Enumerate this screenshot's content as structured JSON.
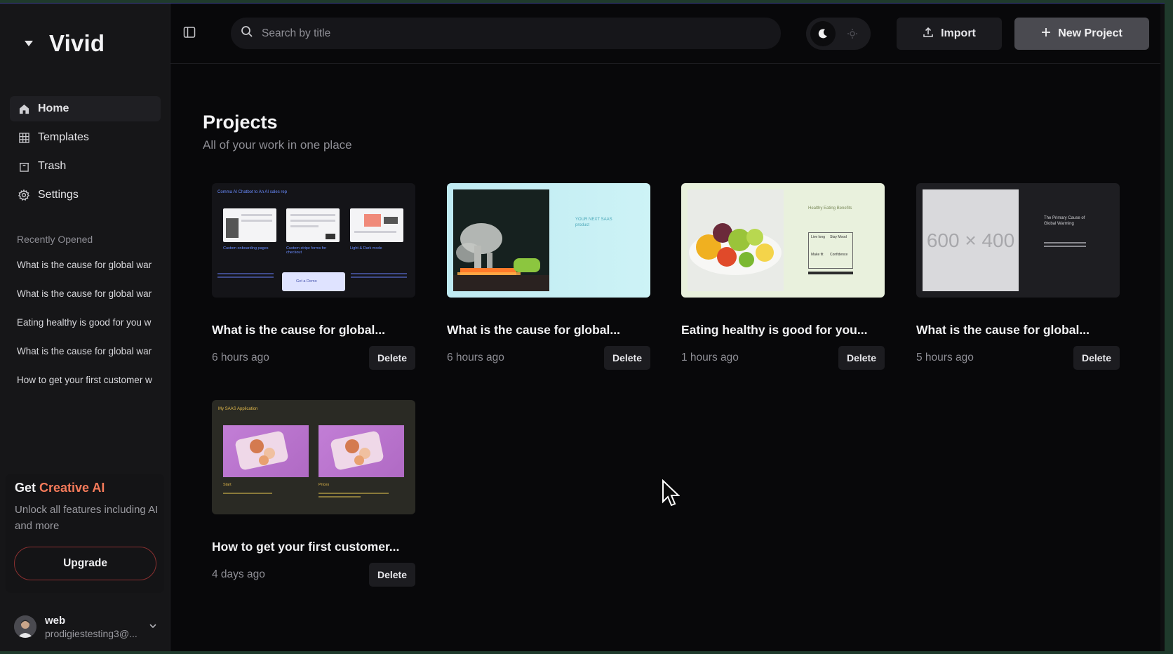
{
  "app": {
    "name": "Vivid"
  },
  "sidebar": {
    "nav": [
      {
        "label": "Home",
        "icon": "home-icon",
        "active": true
      },
      {
        "label": "Templates",
        "icon": "grid-icon",
        "active": false
      },
      {
        "label": "Trash",
        "icon": "trash-icon",
        "active": false
      },
      {
        "label": "Settings",
        "icon": "gear-icon",
        "active": false
      }
    ],
    "recent_title": "Recently Opened",
    "recent": [
      "What is the cause for global war",
      "What is the cause for global war",
      "Eating healthy is good for you w",
      "What is the cause for global war",
      "How to get your first customer w"
    ],
    "promo": {
      "title_prefix": "Get ",
      "title_accent": "Creative AI",
      "description": "Unlock all features including AI and more",
      "button": "Upgrade"
    },
    "user": {
      "name": "web",
      "email": "prodigiestesting3@..."
    }
  },
  "topbar": {
    "search_placeholder": "Search by title",
    "import_label": "Import",
    "new_project_label": "New Project"
  },
  "main": {
    "title": "Projects",
    "subtitle": "All of your work in one place",
    "delete_label": "Delete",
    "projects": [
      {
        "title": "What is the cause for global...",
        "time": "6 hours ago"
      },
      {
        "title": "What is the cause for global...",
        "time": "6 hours ago"
      },
      {
        "title": "Eating healthy is good for you...",
        "time": "1 hours ago"
      },
      {
        "title": "What is the cause for global...",
        "time": "5 hours ago"
      },
      {
        "title": "How to get your first customer...",
        "time": "4 days ago"
      }
    ],
    "thumb_text": {
      "t1_header": "Comma AI Chatbot to An AI sales rep",
      "t1_captions": [
        "Custom onboarding pages",
        "Custom stripe forms for checkout",
        "Light & Dark mode"
      ],
      "t1_cta": "Get a Demo",
      "t2_heading": "YOUR NEXT SAAS product",
      "t3_heading": "Healthy Eating Benefits",
      "t3_cells": [
        "Live long",
        "Stay Mood",
        "Make fit",
        "Confidence"
      ],
      "t4_placeholder": "600 × 400",
      "t4_heading": "The Primary Cause of Global Warming",
      "t5_header": "My SAAS Application",
      "t5_labels": [
        "Start",
        "Prices"
      ]
    }
  },
  "colors": {
    "accent": "#f47a5a",
    "background": "#08080a",
    "sidebar": "#161618",
    "upgrade_border": "#8a3030"
  }
}
